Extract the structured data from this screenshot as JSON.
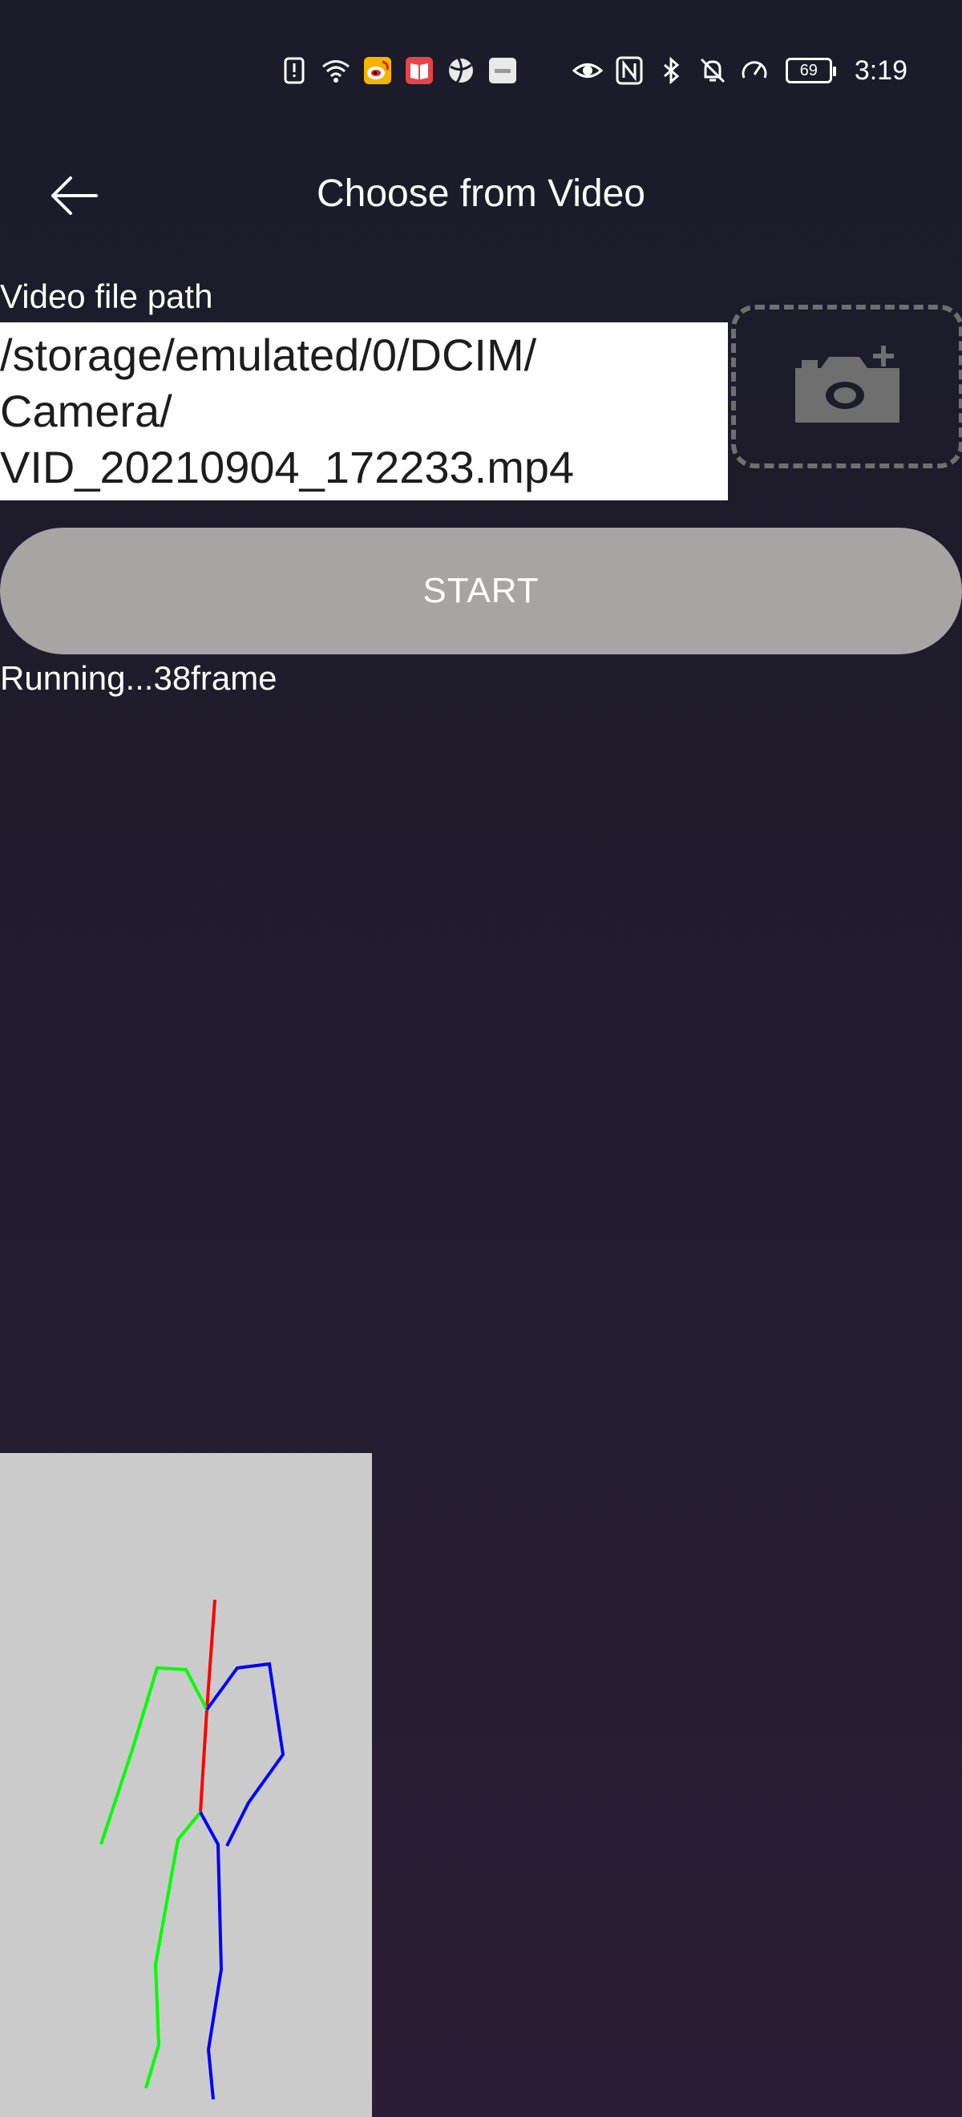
{
  "status_bar": {
    "time": "3:19",
    "battery": "69",
    "icons": [
      "alert-icon",
      "wifi-icon",
      "weibo-icon",
      "book-icon",
      "ball-icon",
      "hms-icon",
      "eye-icon",
      "nfc-icon",
      "bluetooth-icon",
      "bell-off-icon",
      "speed-icon"
    ]
  },
  "header": {
    "title": "Choose from Video",
    "back_icon": "arrow-left-icon"
  },
  "path": {
    "label": "Video file path",
    "value": "/storage/emulated/0/DCIM/\nCamera/\nVID_20210904_172233.mp4",
    "camera_icon": "camera-add-icon"
  },
  "controls": {
    "start_label": "START",
    "status": "Running...38frame"
  },
  "colors": {
    "background_top": "#1b1b29",
    "background_bottom": "#2b1d33",
    "start_button": "#a7a4a4",
    "preview_bg": "#cbcbcb",
    "skeleton_center": "#ff0000",
    "skeleton_left": "#00ff00",
    "skeleton_right": "#0000ff"
  }
}
